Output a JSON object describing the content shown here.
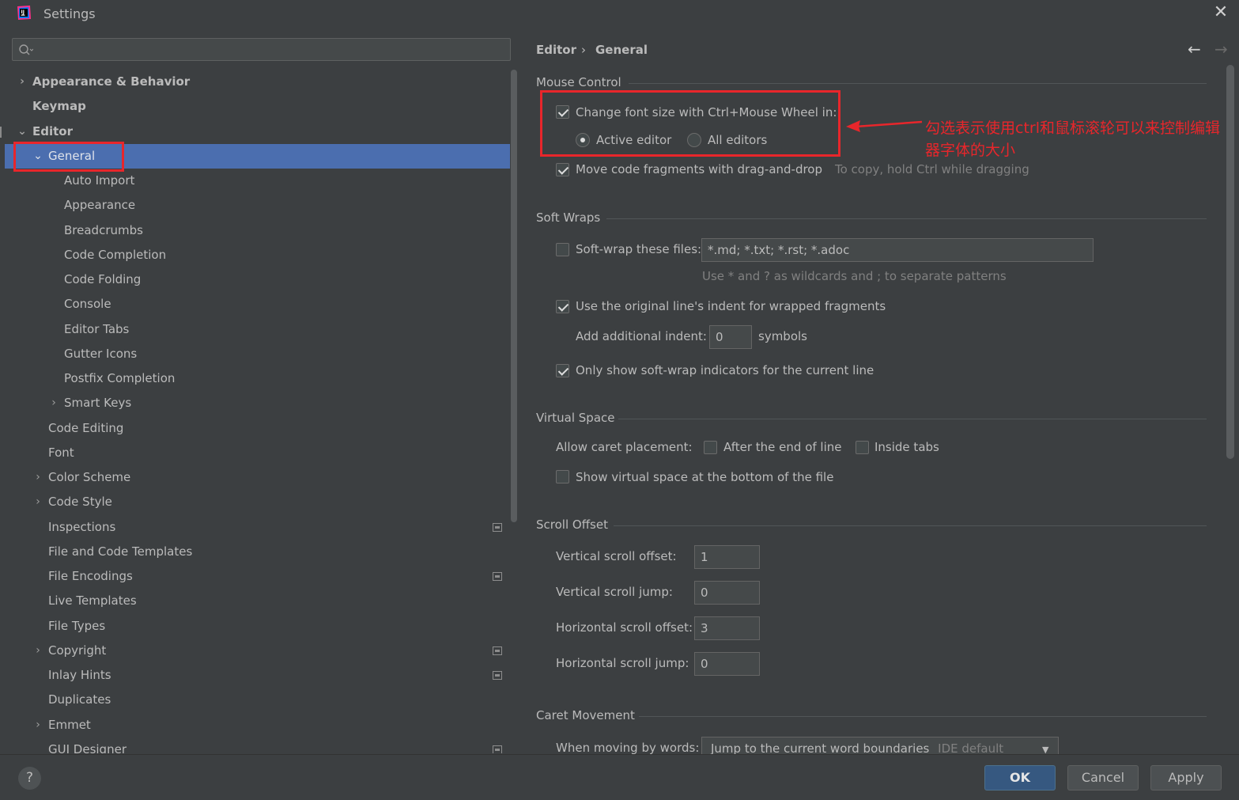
{
  "window": {
    "title": "Settings",
    "close_glyph": "✕"
  },
  "search": {
    "placeholder": "",
    "value": ""
  },
  "tree": {
    "items": [
      {
        "label": "Appearance & Behavior",
        "expand": "›"
      },
      {
        "label": "Keymap",
        "expand": ""
      },
      {
        "label": "Editor",
        "expand": "⌄"
      },
      {
        "label": "General",
        "expand": "⌄"
      },
      {
        "label": "Auto Import",
        "expand": ""
      },
      {
        "label": "Appearance",
        "expand": ""
      },
      {
        "label": "Breadcrumbs",
        "expand": ""
      },
      {
        "label": "Code Completion",
        "expand": ""
      },
      {
        "label": "Code Folding",
        "expand": ""
      },
      {
        "label": "Console",
        "expand": ""
      },
      {
        "label": "Editor Tabs",
        "expand": ""
      },
      {
        "label": "Gutter Icons",
        "expand": ""
      },
      {
        "label": "Postfix Completion",
        "expand": ""
      },
      {
        "label": "Smart Keys",
        "expand": "›"
      },
      {
        "label": "Code Editing",
        "expand": ""
      },
      {
        "label": "Font",
        "expand": ""
      },
      {
        "label": "Color Scheme",
        "expand": "›"
      },
      {
        "label": "Code Style",
        "expand": "›"
      },
      {
        "label": "Inspections",
        "expand": ""
      },
      {
        "label": "File and Code Templates",
        "expand": ""
      },
      {
        "label": "File Encodings",
        "expand": ""
      },
      {
        "label": "Live Templates",
        "expand": ""
      },
      {
        "label": "File Types",
        "expand": ""
      },
      {
        "label": "Copyright",
        "expand": "›"
      },
      {
        "label": "Inlay Hints",
        "expand": ""
      },
      {
        "label": "Duplicates",
        "expand": ""
      },
      {
        "label": "Emmet",
        "expand": "›"
      },
      {
        "label": "GUI Designer",
        "expand": ""
      }
    ]
  },
  "breadcrumb": {
    "parent": "Editor",
    "separator": "›",
    "current": "General",
    "back": "←",
    "forward": "→"
  },
  "mouse_control": {
    "title": "Mouse Control",
    "font_size_wheel": {
      "label": "Change font size with Ctrl+Mouse Wheel in:",
      "checked": true
    },
    "active_editor": {
      "label": "Active editor",
      "selected": true
    },
    "all_editors": {
      "label": "All editors",
      "selected": false
    },
    "drag_drop": {
      "label": "Move code fragments with drag-and-drop",
      "checked": true,
      "hint": "To copy, hold Ctrl while dragging"
    }
  },
  "soft_wraps": {
    "title": "Soft Wraps",
    "wrap_files": {
      "label": "Soft-wrap these files:",
      "checked": false,
      "value": "*.md; *.txt; *.rst; *.adoc",
      "hint": "Use * and ? as wildcards and ; to separate patterns"
    },
    "original_indent": {
      "label": "Use the original line's indent for wrapped fragments",
      "checked": true
    },
    "additional_indent": {
      "label": "Add additional indent:",
      "value": "0",
      "unit": "symbols"
    },
    "indicators": {
      "label": "Only show soft-wrap indicators for the current line",
      "checked": true
    }
  },
  "virtual_space": {
    "title": "Virtual Space",
    "caret_label": "Allow caret placement:",
    "after_end": {
      "label": "After the end of line",
      "checked": false
    },
    "inside_tabs": {
      "label": "Inside tabs",
      "checked": false
    },
    "show_bottom": {
      "label": "Show virtual space at the bottom of the file",
      "checked": false
    }
  },
  "scroll_offset": {
    "title": "Scroll Offset",
    "vertical_offset": {
      "label": "Vertical scroll offset:",
      "value": "1"
    },
    "vertical_jump": {
      "label": "Vertical scroll jump:",
      "value": "0"
    },
    "horizontal_offset": {
      "label": "Horizontal scroll offset:",
      "value": "3"
    },
    "horizontal_jump": {
      "label": "Horizontal scroll jump:",
      "value": "0"
    }
  },
  "caret_movement": {
    "title": "Caret Movement",
    "words_label": "When moving by words:",
    "words_value": "Jump to the current word boundaries",
    "words_default": "IDE default"
  },
  "annotation": {
    "text": "勾选表示使用ctrl和鼠标滚轮可以来控制编辑器字体的大小",
    "color": "#e8262b"
  },
  "footer": {
    "help": "?",
    "ok": "OK",
    "cancel": "Cancel",
    "apply": "Apply"
  },
  "colors": {
    "background": "#3c3f41",
    "selection": "#4b6eaf",
    "ok_button": "#365880",
    "annotation": "#e8262b"
  }
}
